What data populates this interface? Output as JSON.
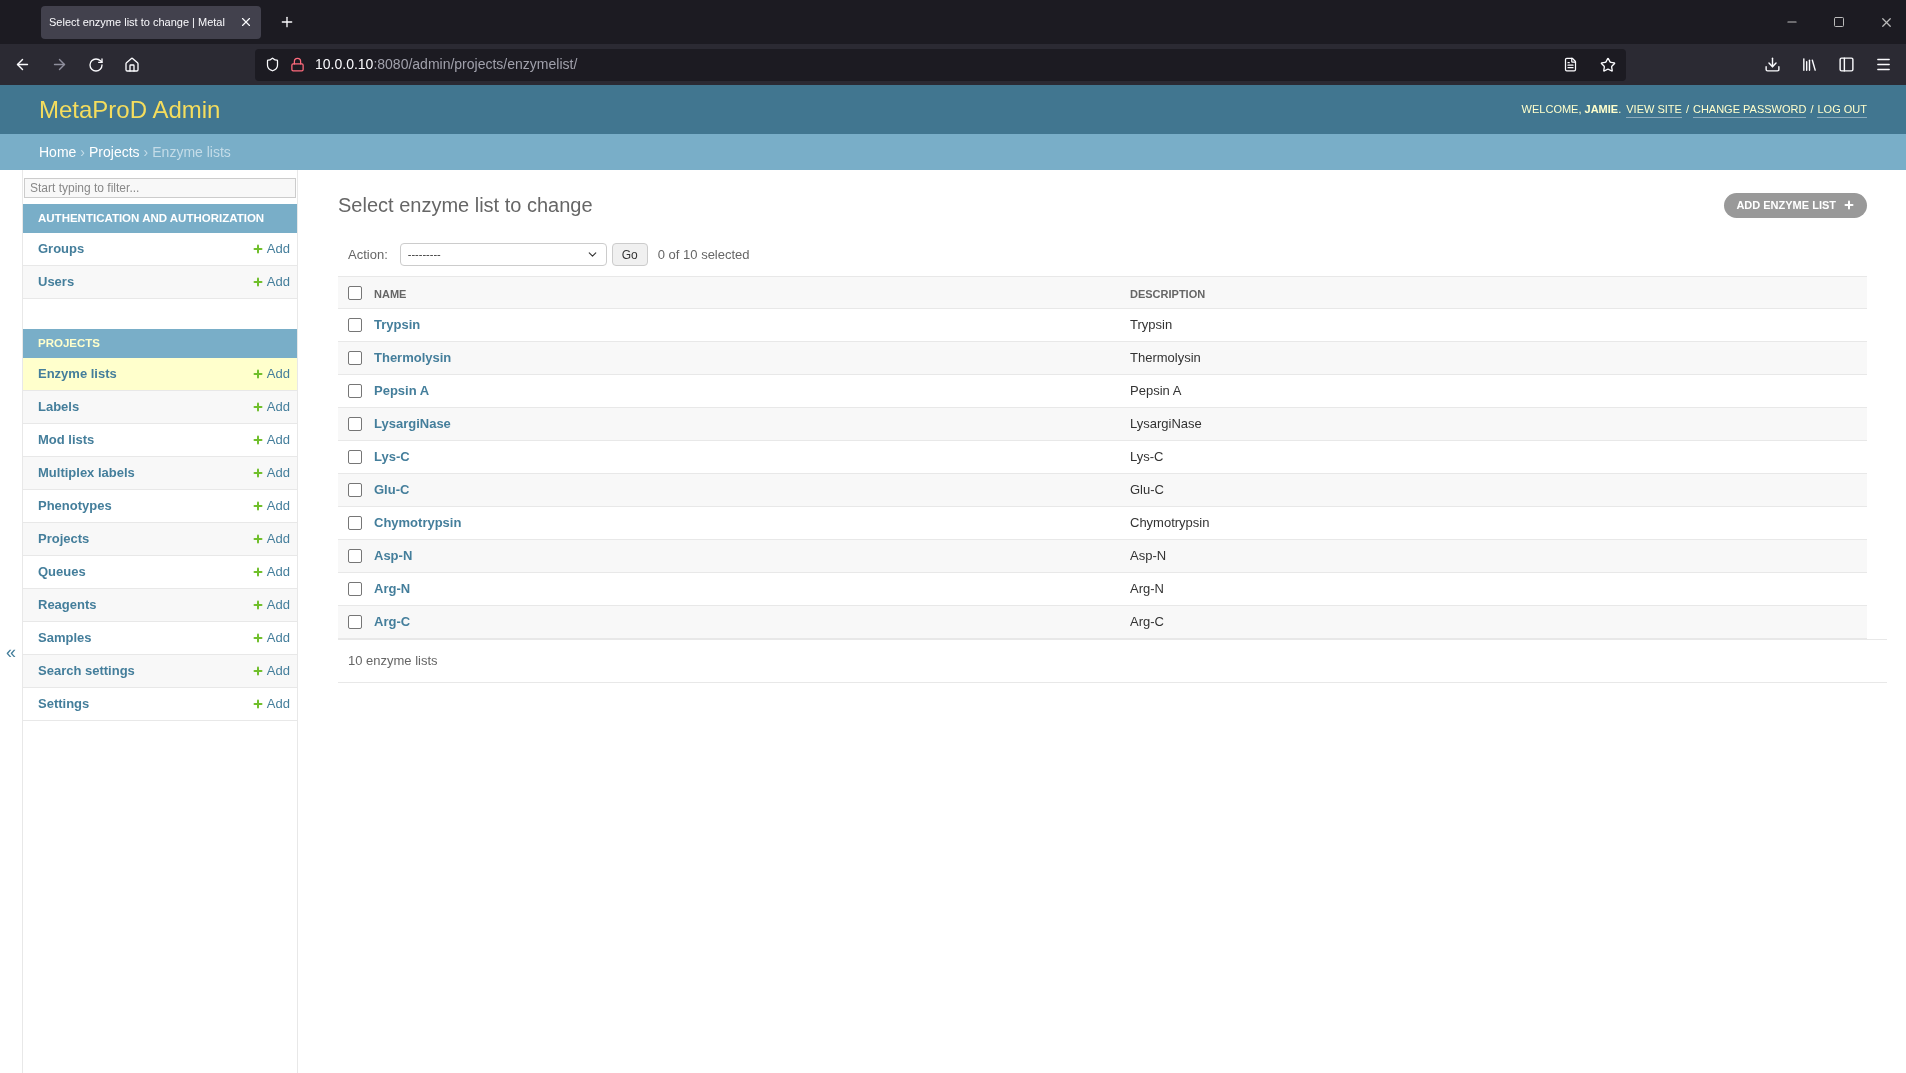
{
  "browser": {
    "tab": {
      "title": "Select enzyme list to change | Metal",
      "selected": true
    },
    "url": {
      "host": "10.0.0.10",
      "path": ":8080/admin/projects/enzymelist/"
    }
  },
  "header": {
    "site_title": "MetaProD Admin",
    "welcome": "WELCOME, **JAMIE**.",
    "links": [
      "VIEW SITE",
      "CHANGE PASSWORD",
      "LOG OUT"
    ],
    "separator": "/"
  },
  "breadcrumbs": {
    "links": [
      "Home",
      "Projects"
    ],
    "separator": "›",
    "current": "Enzyme lists"
  },
  "sidebar": {
    "filter": {
      "placeholder": "Start typing to filter..."
    },
    "collapse": "«",
    "modules": [
      {
        "title": "AUTHENTICATION AND AUTHORIZATION",
        "selected": false,
        "items": [
          {
            "name": "Groups",
            "add": "Add",
            "selected": false
          },
          {
            "name": "Users",
            "add": "Add",
            "selected": false
          }
        ]
      },
      {
        "title": "PROJECTS",
        "selected": true,
        "items": [
          {
            "name": "Enzyme lists",
            "add": "Add",
            "selected": true
          },
          {
            "name": "Labels",
            "add": "Add",
            "selected": false
          },
          {
            "name": "Mod lists",
            "add": "Add",
            "selected": false
          },
          {
            "name": "Multiplex labels",
            "add": "Add",
            "selected": false
          },
          {
            "name": "Phenotypes",
            "add": "Add",
            "selected": false
          },
          {
            "name": "Projects",
            "add": "Add",
            "selected": false
          },
          {
            "name": "Queues",
            "add": "Add",
            "selected": false
          },
          {
            "name": "Reagents",
            "add": "Add",
            "selected": false
          },
          {
            "name": "Samples",
            "add": "Add",
            "selected": false
          },
          {
            "name": "Search settings",
            "add": "Add",
            "selected": false
          },
          {
            "name": "Settings",
            "add": "Add",
            "selected": false
          }
        ]
      }
    ]
  },
  "content": {
    "title": "Select enzyme list to change",
    "add_button": "ADD ENZYME LIST",
    "actions": {
      "label": "Action:",
      "value": "---------",
      "go": "Go",
      "counter": "0 of 10 selected"
    },
    "table": {
      "select_all": {
        "checked": false
      },
      "columns": [
        "NAME",
        "DESCRIPTION"
      ],
      "rows": [
        {
          "name": "Trypsin",
          "description": "Trypsin",
          "checked": false
        },
        {
          "name": "Thermolysin",
          "description": "Thermolysin",
          "checked": false
        },
        {
          "name": "Pepsin A",
          "description": "Pepsin A",
          "checked": false
        },
        {
          "name": "LysargiNase",
          "description": "LysargiNase",
          "checked": false
        },
        {
          "name": "Lys-C",
          "description": "Lys-C",
          "checked": false
        },
        {
          "name": "Glu-C",
          "description": "Glu-C",
          "checked": false
        },
        {
          "name": "Chymotrypsin",
          "description": "Chymotrypsin",
          "checked": false
        },
        {
          "name": "Asp-N",
          "description": "Asp-N",
          "checked": false
        },
        {
          "name": "Arg-N",
          "description": "Arg-N",
          "checked": false
        },
        {
          "name": "Arg-C",
          "description": "Arg-C",
          "checked": false
        }
      ]
    },
    "paginator": "10 enzyme lists"
  }
}
